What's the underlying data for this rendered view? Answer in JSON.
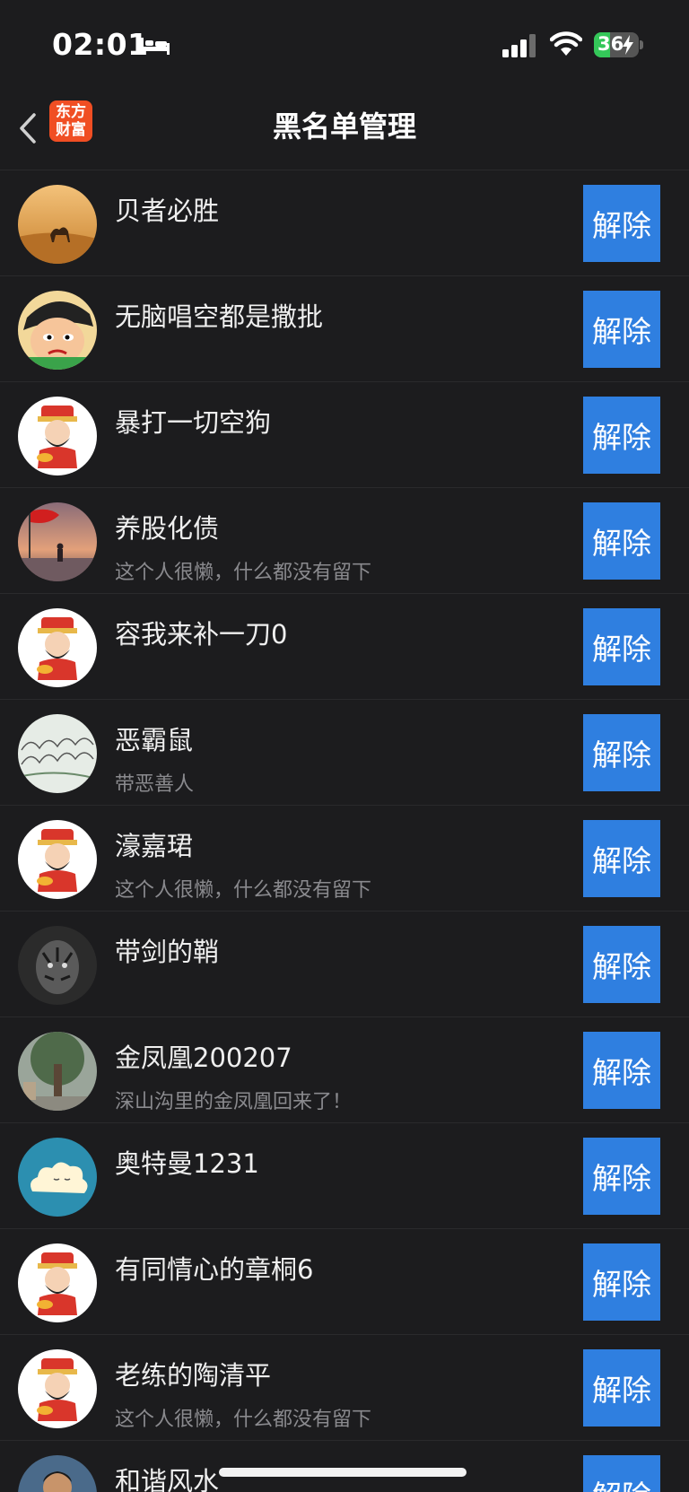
{
  "status_bar": {
    "time": "02:01",
    "battery_pct": "36",
    "battery_level": 0.36,
    "battery_color": "#34c759",
    "icons": [
      "bed-icon",
      "signal-icon",
      "wifi-icon",
      "battery-icon",
      "charging-bolt-icon"
    ]
  },
  "nav": {
    "title": "黑名单管理",
    "back_icon": "chevron-left-icon",
    "logo_line1": "东方",
    "logo_line2": "财富"
  },
  "button_color": "#2f7fe0",
  "blocked_users": [
    {
      "name": "贝者必胜",
      "bio": "",
      "avatar": "desert-camel-avatar",
      "unblock_label": "解除"
    },
    {
      "name": "无脑唱空都是撒批",
      "bio": "",
      "avatar": "cartoon-face-avatar",
      "unblock_label": "解除"
    },
    {
      "name": "暴打一切空狗",
      "bio": "",
      "avatar": "fortune-god-avatar",
      "unblock_label": "解除"
    },
    {
      "name": "养股化债",
      "bio": "这个人很懒，什么都没有留下",
      "avatar": "red-flag-sunset-avatar",
      "unblock_label": "解除"
    },
    {
      "name": "容我来补一刀0",
      "bio": "",
      "avatar": "fortune-god-avatar",
      "unblock_label": "解除"
    },
    {
      "name": "恶霸鼠",
      "bio": "带恶善人",
      "avatar": "sketch-drawing-avatar",
      "unblock_label": "解除"
    },
    {
      "name": "濠嘉珺",
      "bio": "这个人很懒，什么都没有留下",
      "avatar": "fortune-god-avatar",
      "unblock_label": "解除"
    },
    {
      "name": "带剑的鞘",
      "bio": "",
      "avatar": "tiger-avatar",
      "unblock_label": "解除"
    },
    {
      "name": "金凤凰200207",
      "bio": "深山沟里的金凤凰回来了！",
      "avatar": "tree-park-avatar",
      "unblock_label": "解除"
    },
    {
      "name": "奥特曼1231",
      "bio": "",
      "avatar": "cloud-avatar",
      "unblock_label": "解除"
    },
    {
      "name": "有同情心的章桐6",
      "bio": "",
      "avatar": "fortune-god-avatar",
      "unblock_label": "解除"
    },
    {
      "name": "老练的陶清平",
      "bio": "这个人很懒，什么都没有留下",
      "avatar": "fortune-god-avatar",
      "unblock_label": "解除"
    },
    {
      "name": "和谐风水",
      "bio": "",
      "avatar": "person-photo-avatar",
      "unblock_label": "解除"
    }
  ]
}
